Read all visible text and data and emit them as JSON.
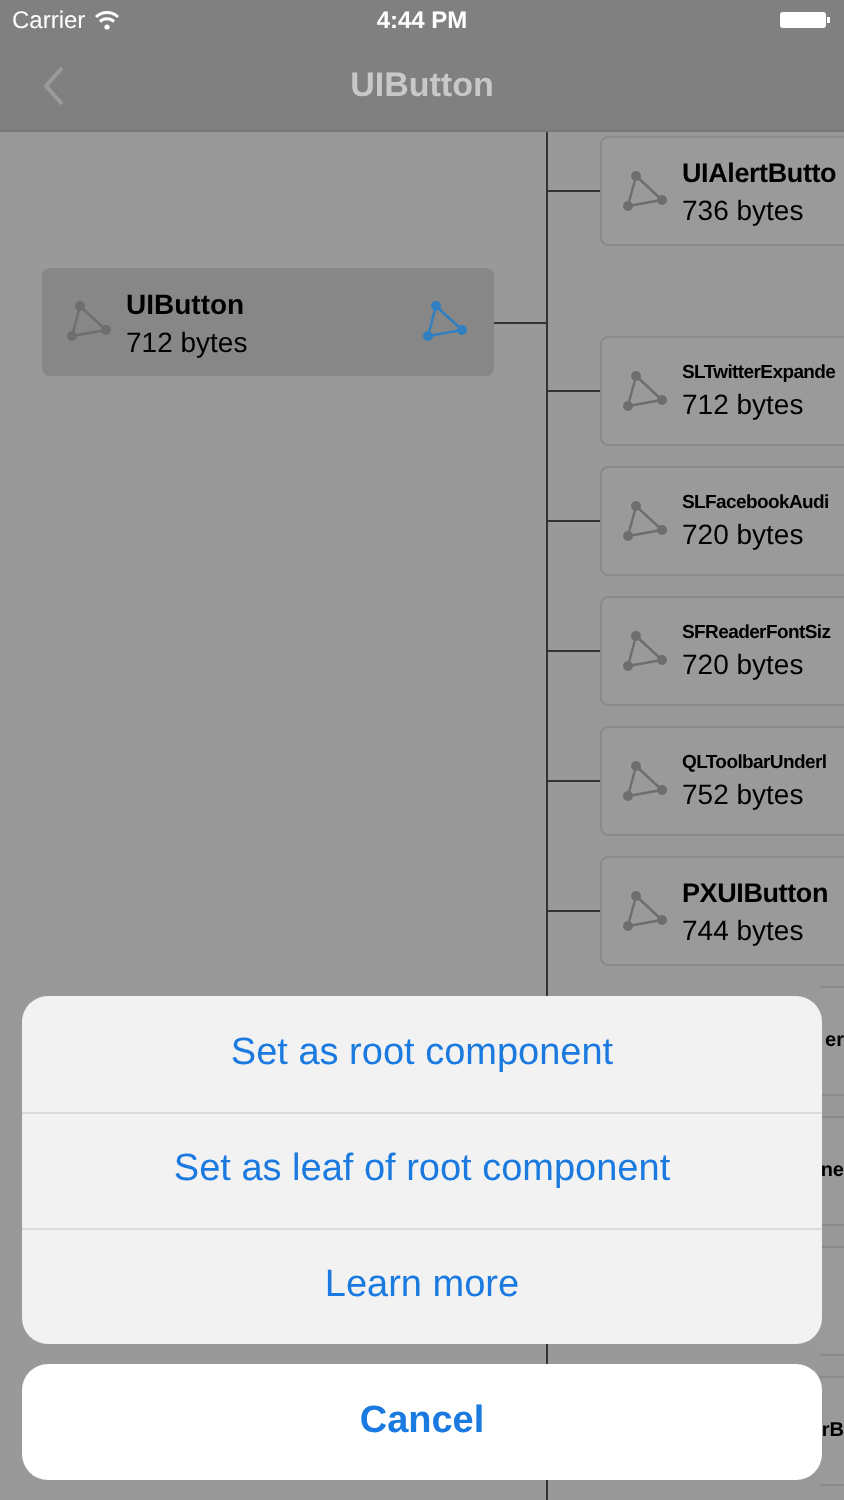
{
  "status_bar": {
    "carrier": "Carrier",
    "time": "4:44 PM"
  },
  "nav_bar": {
    "title": "UIButton"
  },
  "root": {
    "name": "UIButton",
    "size": "712 bytes"
  },
  "children": [
    {
      "kind": "card",
      "name": "UIAlertButto",
      "size": "736 bytes"
    },
    {
      "kind": "card",
      "name": "SLTwitterExpande",
      "size": "712 bytes"
    },
    {
      "kind": "card",
      "name": "SLFacebookAudi",
      "size": "720 bytes"
    },
    {
      "kind": "card",
      "name": "SFReaderFontSiz",
      "size": "720 bytes"
    },
    {
      "kind": "card",
      "name": "QLToolbarUnderl",
      "size": "752 bytes"
    },
    {
      "kind": "card",
      "name": "PXUIButton",
      "size": "744 bytes"
    },
    {
      "kind": "covered",
      "name": "er"
    },
    {
      "kind": "covered",
      "name": "ne"
    },
    {
      "kind": "covered"
    },
    {
      "kind": "covered",
      "name": "rB"
    }
  ],
  "action_sheet": {
    "actions": [
      "Set as root component",
      "Set as leaf of root component",
      "Learn more"
    ],
    "cancel": "Cancel"
  }
}
